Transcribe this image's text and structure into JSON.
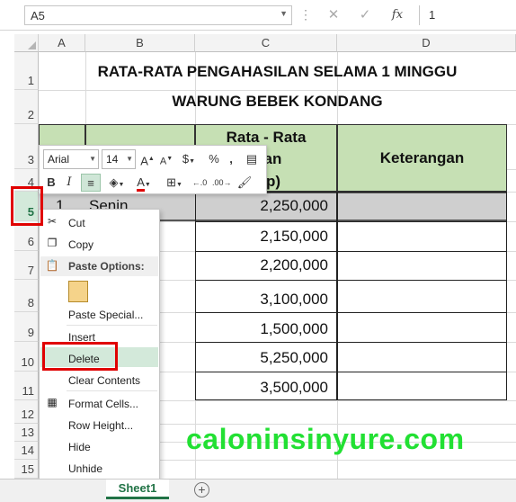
{
  "formula_bar": {
    "name_box": "A5",
    "cancel_icon": "✕",
    "enter_icon": "✓",
    "fx_label": "fx",
    "value": "1"
  },
  "columns": [
    "A",
    "B",
    "C",
    "D"
  ],
  "rows": [
    "1",
    "2",
    "3",
    "4",
    "5",
    "6",
    "7",
    "8",
    "9",
    "10",
    "11",
    "12",
    "13",
    "14",
    "15"
  ],
  "sheet": {
    "title1": "RATA-RATA PENGAHASILAN SELAMA 1 MINGGU",
    "title2": "WARUNG BEBEK KONDANG",
    "header_c_line1": "Rata - Rata",
    "header_c_line2": "patan",
    "header_c_line3": "p)",
    "header_d": "Keterangan",
    "row5_no": "1",
    "row5_day": "Senin",
    "values": [
      "2,250,000",
      "2,150,000",
      "2,200,000",
      "3,100,000",
      "1,500,000",
      "5,250,000",
      "3,500,000"
    ]
  },
  "mini_toolbar": {
    "font": "Arial",
    "size": "14"
  },
  "context_menu": {
    "cut": "Cut",
    "copy": "Copy",
    "paste_options": "Paste Options:",
    "paste_special": "Paste Special...",
    "insert": "Insert",
    "delete": "Delete",
    "clear_contents": "Clear Contents",
    "format_cells": "Format Cells...",
    "row_height": "Row Height...",
    "hide": "Hide",
    "unhide": "Unhide"
  },
  "watermark": "caloninsinyure.com",
  "tabs": {
    "sheet1": "Sheet1"
  },
  "colors": {
    "header_fill": "#c6e0b4",
    "accent": "#217346",
    "highlight": "#e00000",
    "watermark": "#22e033"
  }
}
